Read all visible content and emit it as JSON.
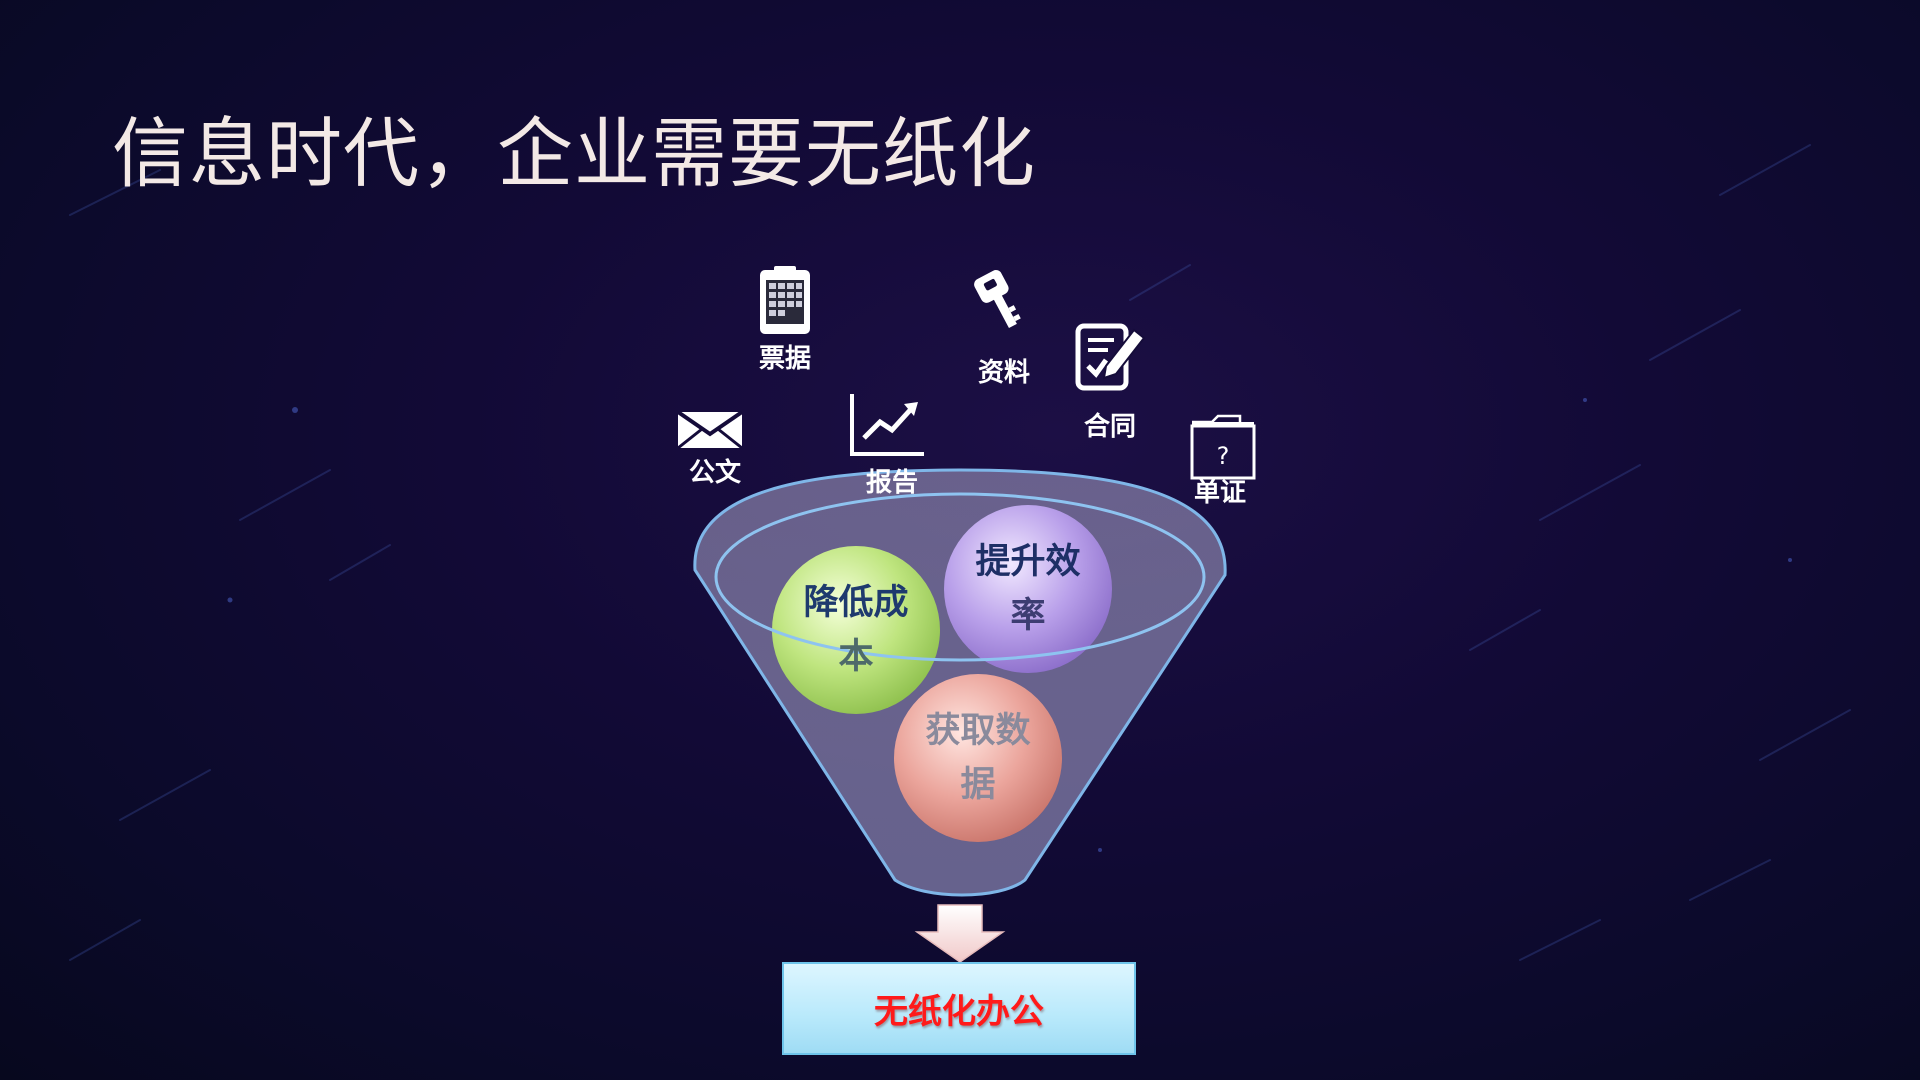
{
  "slide": {
    "title": "信息时代，企业需要无纸化"
  },
  "inputs": [
    {
      "label": "票据",
      "icon": "clipboard-icon"
    },
    {
      "label": "资料",
      "icon": "key-icon"
    },
    {
      "label": "合同",
      "icon": "signed-document-icon"
    },
    {
      "label": "公文",
      "icon": "envelope-icon"
    },
    {
      "label": "报告",
      "icon": "line-chart-icon"
    },
    {
      "label": "单证",
      "icon": "folder-question-icon"
    }
  ],
  "spheres": [
    {
      "line1": "降低成",
      "line2": "本",
      "color": "#b8e27a"
    },
    {
      "line1": "提升效",
      "line2": "率",
      "color": "#b79ae6"
    },
    {
      "line1": "获取数",
      "line2": "据",
      "color": "#e79a92"
    }
  ],
  "output": {
    "label": "无纸化办公"
  }
}
